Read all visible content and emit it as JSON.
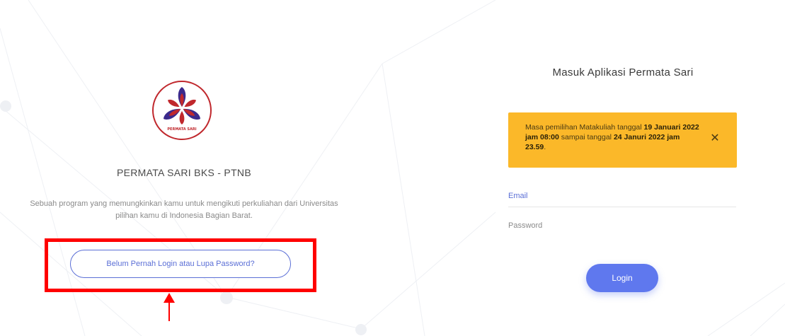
{
  "left": {
    "site_title": "PERMATA SARI BKS - PTNB",
    "description": "Sebuah program yang memungkinkan kamu untuk mengikuti perkuliahan dari Universitas pilihan kamu di Indonesia Bagian Barat.",
    "forgot_button_label": "Belum Pernah Login atau Lupa Password?",
    "logo_caption": "PERMATA SARI"
  },
  "right": {
    "login_title": "Masuk Aplikasi Permata Sari",
    "alert": {
      "text_1": "Masa pemilihan Matakuliah tanggal ",
      "bold_1": "19 Januari 2022 jam 08:00",
      "text_2": " sampai tanggal ",
      "bold_2": "24 Januri 2022 jam 23.59",
      "text_3": ".",
      "close_glyph": "✕"
    },
    "email_placeholder": "Email",
    "password_placeholder": "Password",
    "login_button_label": "Login"
  },
  "colors": {
    "accent": "#5f78ee",
    "alert_bg": "#fbb829",
    "highlight": "#ff0000",
    "logo_red": "#c0282d",
    "logo_purple": "#3b2a8c"
  }
}
